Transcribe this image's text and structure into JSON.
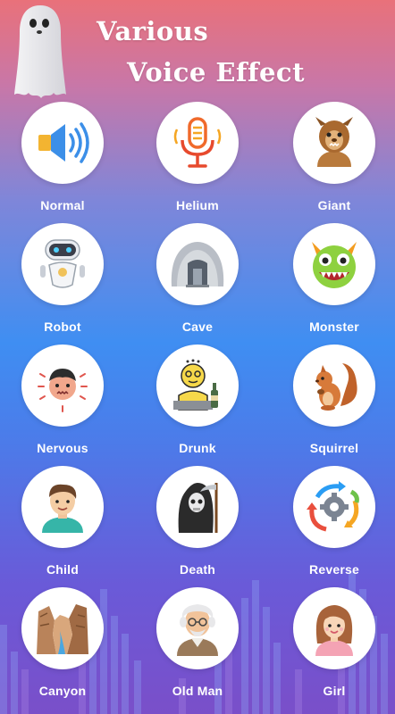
{
  "header": {
    "title_line1": "Various",
    "title_line2": "Voice Effect"
  },
  "effects": [
    {
      "label": "Normal",
      "icon": "speaker-icon"
    },
    {
      "label": "Helium",
      "icon": "microphone-icon"
    },
    {
      "label": "Giant",
      "icon": "giant-icon"
    },
    {
      "label": "Robot",
      "icon": "robot-icon"
    },
    {
      "label": "Cave",
      "icon": "cave-icon"
    },
    {
      "label": "Monster",
      "icon": "monster-icon"
    },
    {
      "label": "Nervous",
      "icon": "nervous-face-icon"
    },
    {
      "label": "Drunk",
      "icon": "drunk-icon"
    },
    {
      "label": "Squirrel",
      "icon": "squirrel-icon"
    },
    {
      "label": "Child",
      "icon": "child-icon"
    },
    {
      "label": "Death",
      "icon": "grim-reaper-icon"
    },
    {
      "label": "Reverse",
      "icon": "reverse-gear-icon"
    },
    {
      "label": "Canyon",
      "icon": "canyon-icon"
    },
    {
      "label": "Old Man",
      "icon": "old-man-icon"
    },
    {
      "label": "Girl",
      "icon": "girl-icon"
    }
  ],
  "colors": {
    "gradient_top": "#e9717a",
    "gradient_mid": "#3f8ef2",
    "gradient_bottom": "#7a4fc9",
    "label": "#ffffff"
  }
}
